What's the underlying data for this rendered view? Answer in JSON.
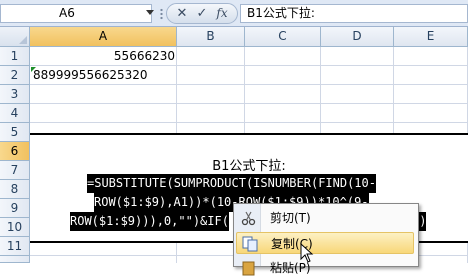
{
  "formula_bar": {
    "name_box": "A6",
    "fx_label": "fx",
    "content": "B1公式下拉:"
  },
  "columns": [
    "A",
    "B",
    "C",
    "D",
    "E"
  ],
  "rows": [
    "1",
    "2",
    "3",
    "4",
    "5",
    "6",
    "7",
    "8",
    "9",
    "10",
    "11"
  ],
  "cells": {
    "A1": "55666230",
    "A2": "889999556625320"
  },
  "textbox": {
    "title": "B1公式下拉:",
    "lines": [
      "=SUBSTITUTE(SUMPRODUCT(ISNUMBER(FIND(10-",
      "ROW($1:$9),A1))*(10-ROW($1:$9))*10^(9-",
      "ROW($1:$9))),0,\"\")&IF(",
      "\")"
    ]
  },
  "context_menu": {
    "items": [
      {
        "label": "剪切(T)",
        "icon": "scissors-icon"
      },
      {
        "label": "复制(C)",
        "icon": "copy-icon",
        "highlighted": true
      },
      {
        "label": "粘贴(P)",
        "icon": "paste-icon"
      }
    ]
  },
  "colors": {
    "selected_header": "#f8d88d",
    "formula_highlight": "#000000",
    "menu_hover": "#f8d779"
  }
}
